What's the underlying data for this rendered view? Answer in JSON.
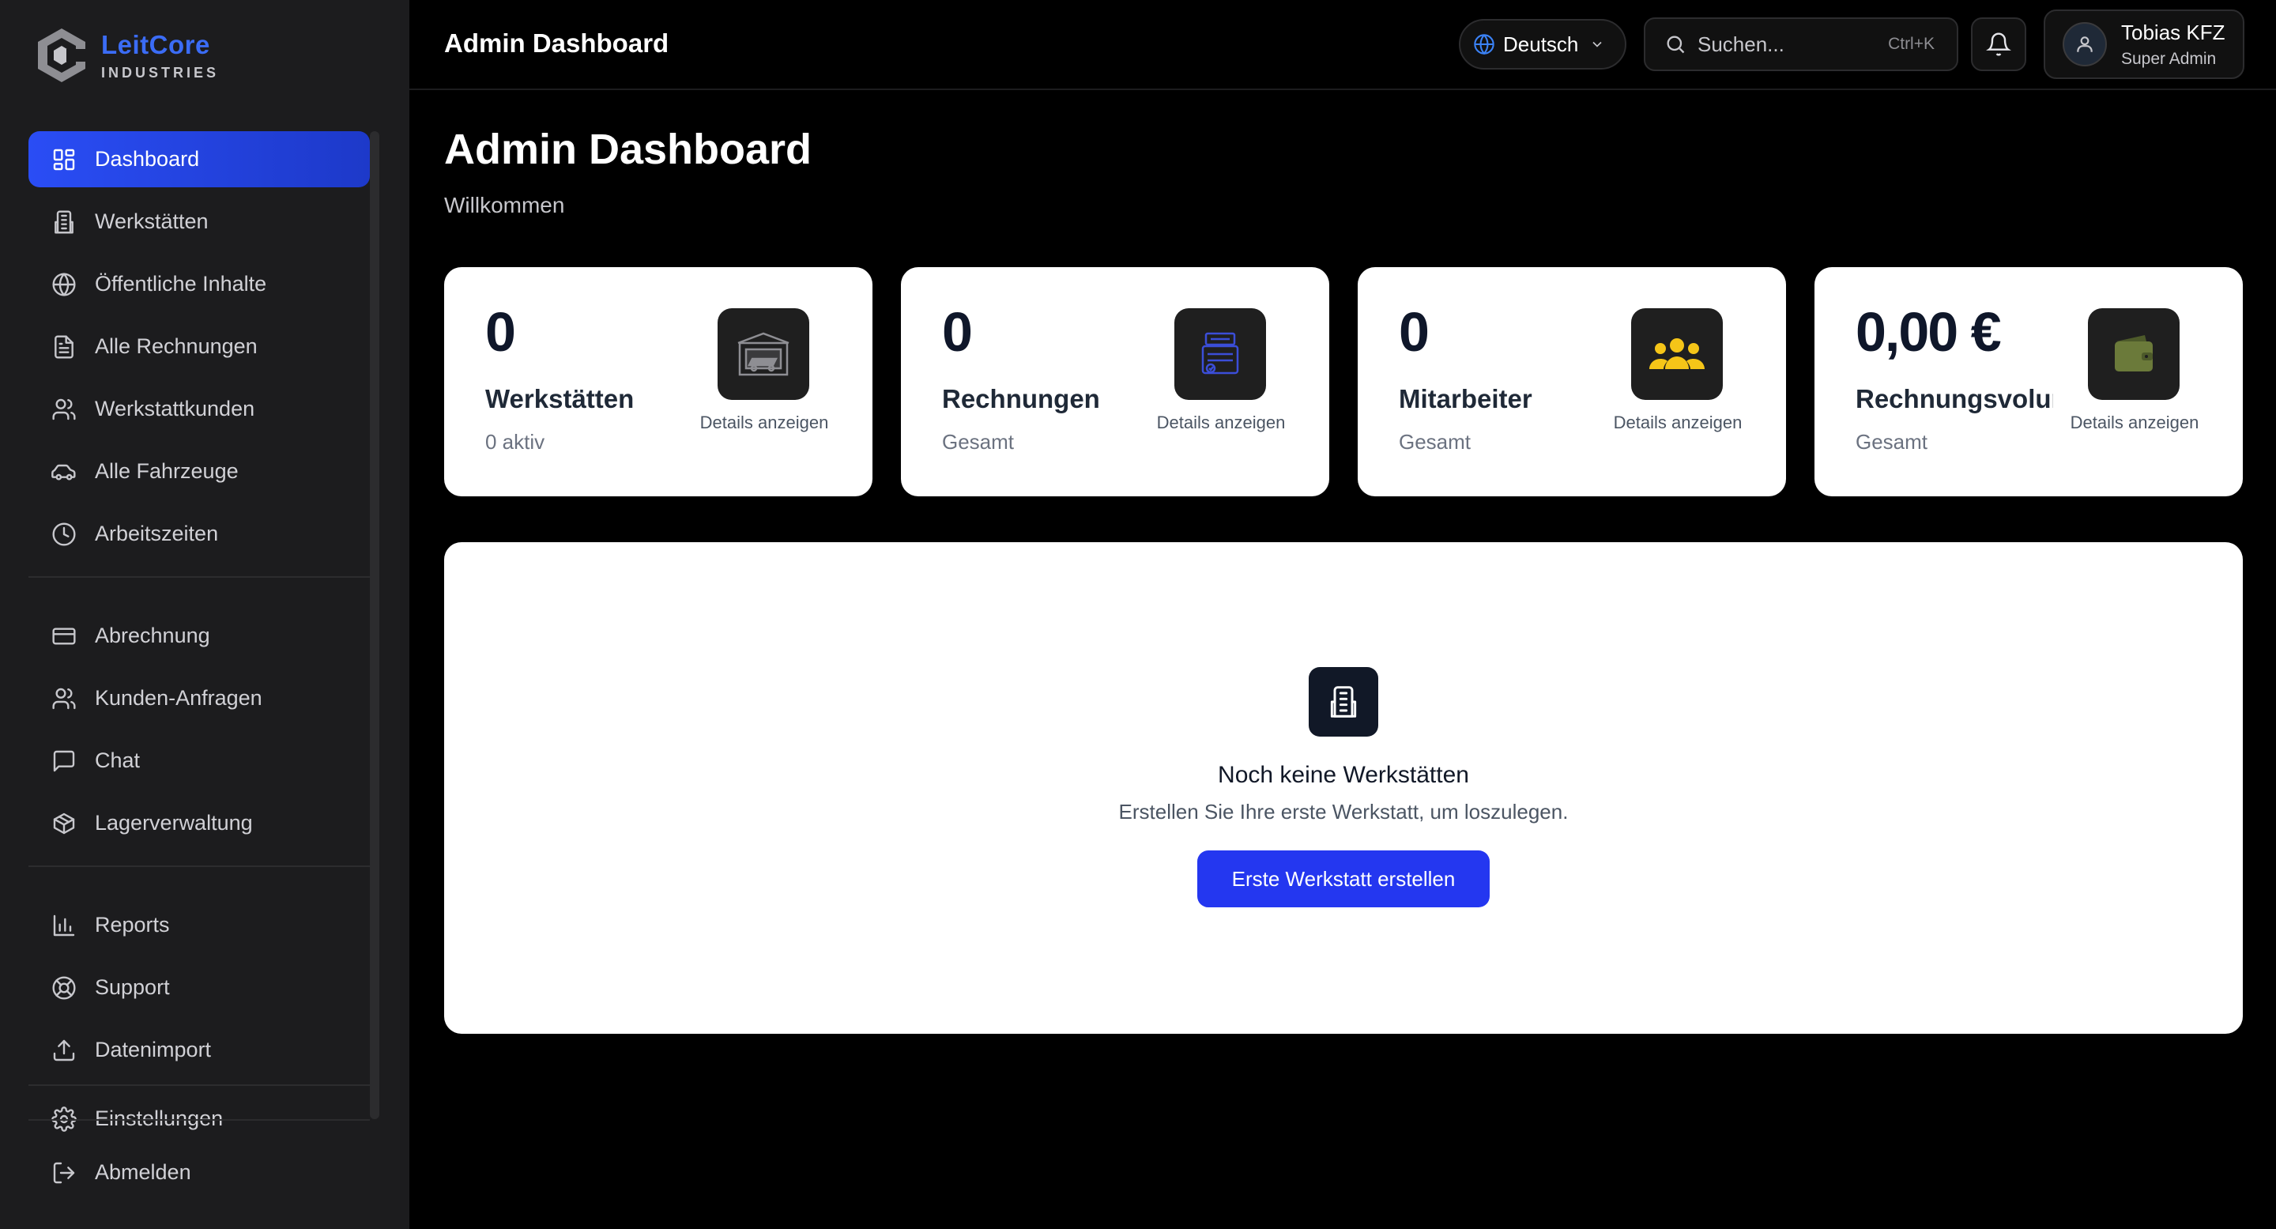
{
  "brand": {
    "name": "LeitCore",
    "tagline": "INDUSTRIES",
    "accent": "#3b6cf6"
  },
  "sidebar": {
    "items": [
      {
        "label": "Dashboard",
        "icon": "dashboard-grid-icon",
        "active": true
      },
      {
        "label": "Werkstätten",
        "icon": "building-icon"
      },
      {
        "label": "Öffentliche Inhalte",
        "icon": "globe-icon"
      },
      {
        "label": "Alle Rechnungen",
        "icon": "document-icon"
      },
      {
        "label": "Werkstattkunden",
        "icon": "users-icon"
      },
      {
        "label": "Alle Fahrzeuge",
        "icon": "car-icon"
      },
      {
        "label": "Arbeitszeiten",
        "icon": "clock-icon"
      },
      {
        "label": "Abrechnung",
        "icon": "credit-card-icon"
      },
      {
        "label": "Kunden-Anfragen",
        "icon": "users-icon"
      },
      {
        "label": "Chat",
        "icon": "chat-icon"
      },
      {
        "label": "Lagerverwaltung",
        "icon": "package-icon"
      },
      {
        "label": "Reports",
        "icon": "bar-chart-icon"
      },
      {
        "label": "Support",
        "icon": "lifebuoy-icon"
      },
      {
        "label": "Datenimport",
        "icon": "upload-icon"
      },
      {
        "label": "Einstellungen",
        "icon": "gear-icon"
      }
    ],
    "logout": {
      "label": "Abmelden",
      "icon": "logout-icon"
    }
  },
  "topbar": {
    "title": "Admin Dashboard",
    "language": "Deutsch",
    "search": {
      "placeholder": "Suchen...",
      "shortcut": "Ctrl+K"
    },
    "user": {
      "name": "Tobias KFZ",
      "role": "Super Admin"
    }
  },
  "page": {
    "title": "Admin Dashboard",
    "subtitle": "Willkommen"
  },
  "stats": [
    {
      "value": "0",
      "title": "Werkstätten",
      "sub": "0 aktiv",
      "link": "Details anzeigen",
      "icon": "garage-icon",
      "color": "#8e8e93"
    },
    {
      "value": "0",
      "title": "Rechnungen",
      "sub": "Gesamt",
      "link": "Details anzeigen",
      "icon": "invoice-icon",
      "color": "#3b4ed8"
    },
    {
      "value": "0",
      "title": "Mitarbeiter",
      "sub": "Gesamt",
      "link": "Details anzeigen",
      "icon": "team-icon",
      "color": "#f5c518"
    },
    {
      "value": "0,00 €",
      "title": "Rechnungsvolumen",
      "sub": "Gesamt",
      "link": "Details anzeigen",
      "icon": "wallet-icon",
      "color": "#6b7a3a"
    }
  ],
  "empty_state": {
    "title": "Noch keine Werkstätten",
    "subtitle": "Erstellen Sie Ihre erste Werkstatt, um loszulegen.",
    "button": "Erste Werkstatt erstellen"
  }
}
